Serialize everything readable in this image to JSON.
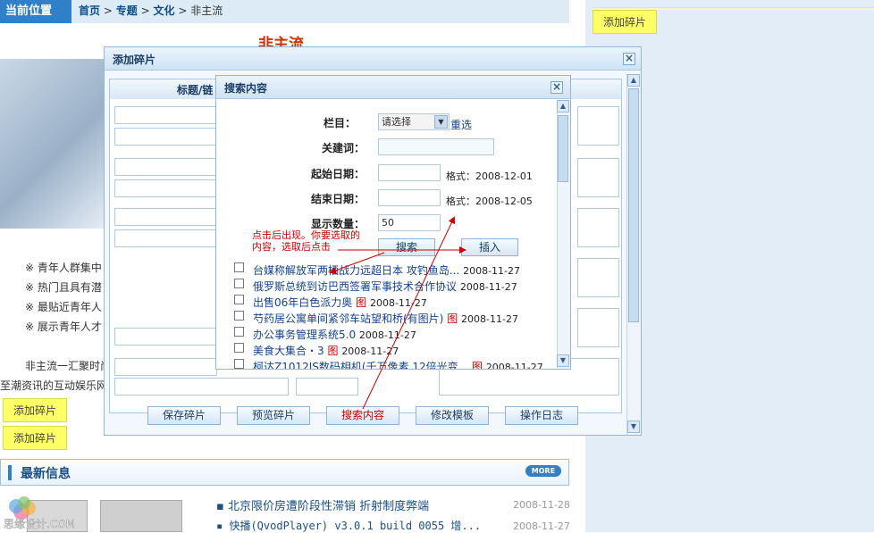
{
  "breadcrumb": {
    "label": "当前位置",
    "home": "首页",
    "sep": ">",
    "topic": "专题",
    "culture": "文化",
    "current": "非主流"
  },
  "page_title": "非主流",
  "right_panel": {
    "add_button": "添加碎片"
  },
  "left_list": {
    "bullets": [
      "※ 青年人群集中",
      "※ 热门且具有潜",
      "※ 最贴近青年人",
      "※ 展示青年人才"
    ],
    "intro_line1": "非主流一汇聚时尚",
    "intro_line2": "至潮资讯的互动娱乐网",
    "add_buttons": [
      "添加碎片",
      "添加碎片"
    ]
  },
  "latest": {
    "title": "最新信息",
    "more": "MORE",
    "items": [
      {
        "text": "北京限价房遭阶段性滞销 折射制度弊端",
        "date": "2008-11-28"
      },
      {
        "text": "快播(QvodPlayer) v3.0.1 build 0055 增...",
        "date": "2008-11-27"
      }
    ],
    "watermark": "思缘设计.COM"
  },
  "dialog_add": {
    "title": "添加碎片",
    "column_header": "标题/链",
    "buttons": [
      "保存碎片",
      "预览碎片",
      "搜索内容",
      "修改模板",
      "操作日志"
    ]
  },
  "dialog_search": {
    "title": "搜索内容",
    "column_label": "栏目：",
    "column_value": "请选择",
    "reset_link": "重选",
    "keyword_label": "关建词：",
    "keyword_value": "",
    "start_label": "起始日期：",
    "start_value": "",
    "start_format": "格式：2008-12-01",
    "end_label": "结束日期：",
    "end_value": "",
    "end_format": "格式：2008-12-05",
    "count_label": "显示数量：",
    "count_value": "50",
    "search_button": "搜索",
    "insert_button": "插入",
    "note_line1": "点击后出现。你要选取的",
    "note_line2": "内容，选取后点击",
    "results": [
      {
        "title": "台媒称解放军两栖战力远超日本 攻钓鱼岛...",
        "date": "2008-11-27",
        "has_image": false
      },
      {
        "title": "俄罗斯总统到访巴西签署军事技术合作协议",
        "date": "2008-11-27",
        "has_image": false
      },
      {
        "title": "出售06年白色派力奥",
        "date": "2008-11-27",
        "has_image": true
      },
      {
        "title": "芍药居公寓单间紧邻车站望和桥(有图片)",
        "date": "2008-11-27",
        "has_image": true
      },
      {
        "title": "办公事务管理系统5.0",
        "date": "2008-11-27",
        "has_image": false
      },
      {
        "title": "美食大集合・3",
        "date": "2008-11-27",
        "has_image": true
      },
      {
        "title": "柯达Z1012IS数码相机(千万像素 12倍光变...",
        "date": "2008-11-27",
        "has_image": true
      }
    ],
    "image_marker": "图"
  }
}
